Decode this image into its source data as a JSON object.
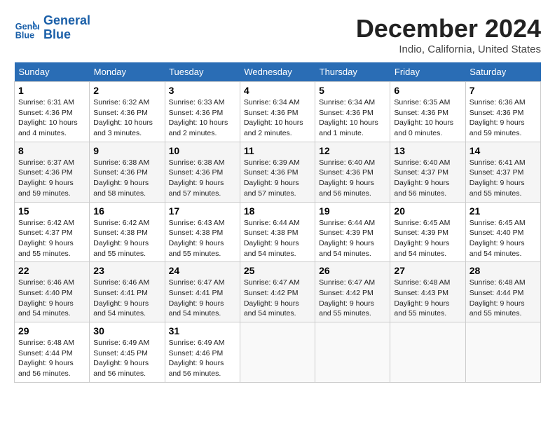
{
  "header": {
    "logo_line1": "General",
    "logo_line2": "Blue",
    "month": "December 2024",
    "location": "Indio, California, United States"
  },
  "weekdays": [
    "Sunday",
    "Monday",
    "Tuesday",
    "Wednesday",
    "Thursday",
    "Friday",
    "Saturday"
  ],
  "weeks": [
    [
      {
        "day": "1",
        "info": "Sunrise: 6:31 AM\nSunset: 4:36 PM\nDaylight: 10 hours\nand 4 minutes."
      },
      {
        "day": "2",
        "info": "Sunrise: 6:32 AM\nSunset: 4:36 PM\nDaylight: 10 hours\nand 3 minutes."
      },
      {
        "day": "3",
        "info": "Sunrise: 6:33 AM\nSunset: 4:36 PM\nDaylight: 10 hours\nand 2 minutes."
      },
      {
        "day": "4",
        "info": "Sunrise: 6:34 AM\nSunset: 4:36 PM\nDaylight: 10 hours\nand 2 minutes."
      },
      {
        "day": "5",
        "info": "Sunrise: 6:34 AM\nSunset: 4:36 PM\nDaylight: 10 hours\nand 1 minute."
      },
      {
        "day": "6",
        "info": "Sunrise: 6:35 AM\nSunset: 4:36 PM\nDaylight: 10 hours\nand 0 minutes."
      },
      {
        "day": "7",
        "info": "Sunrise: 6:36 AM\nSunset: 4:36 PM\nDaylight: 9 hours\nand 59 minutes."
      }
    ],
    [
      {
        "day": "8",
        "info": "Sunrise: 6:37 AM\nSunset: 4:36 PM\nDaylight: 9 hours\nand 59 minutes."
      },
      {
        "day": "9",
        "info": "Sunrise: 6:38 AM\nSunset: 4:36 PM\nDaylight: 9 hours\nand 58 minutes."
      },
      {
        "day": "10",
        "info": "Sunrise: 6:38 AM\nSunset: 4:36 PM\nDaylight: 9 hours\nand 57 minutes."
      },
      {
        "day": "11",
        "info": "Sunrise: 6:39 AM\nSunset: 4:36 PM\nDaylight: 9 hours\nand 57 minutes."
      },
      {
        "day": "12",
        "info": "Sunrise: 6:40 AM\nSunset: 4:36 PM\nDaylight: 9 hours\nand 56 minutes."
      },
      {
        "day": "13",
        "info": "Sunrise: 6:40 AM\nSunset: 4:37 PM\nDaylight: 9 hours\nand 56 minutes."
      },
      {
        "day": "14",
        "info": "Sunrise: 6:41 AM\nSunset: 4:37 PM\nDaylight: 9 hours\nand 55 minutes."
      }
    ],
    [
      {
        "day": "15",
        "info": "Sunrise: 6:42 AM\nSunset: 4:37 PM\nDaylight: 9 hours\nand 55 minutes."
      },
      {
        "day": "16",
        "info": "Sunrise: 6:42 AM\nSunset: 4:38 PM\nDaylight: 9 hours\nand 55 minutes."
      },
      {
        "day": "17",
        "info": "Sunrise: 6:43 AM\nSunset: 4:38 PM\nDaylight: 9 hours\nand 55 minutes."
      },
      {
        "day": "18",
        "info": "Sunrise: 6:44 AM\nSunset: 4:38 PM\nDaylight: 9 hours\nand 54 minutes."
      },
      {
        "day": "19",
        "info": "Sunrise: 6:44 AM\nSunset: 4:39 PM\nDaylight: 9 hours\nand 54 minutes."
      },
      {
        "day": "20",
        "info": "Sunrise: 6:45 AM\nSunset: 4:39 PM\nDaylight: 9 hours\nand 54 minutes."
      },
      {
        "day": "21",
        "info": "Sunrise: 6:45 AM\nSunset: 4:40 PM\nDaylight: 9 hours\nand 54 minutes."
      }
    ],
    [
      {
        "day": "22",
        "info": "Sunrise: 6:46 AM\nSunset: 4:40 PM\nDaylight: 9 hours\nand 54 minutes."
      },
      {
        "day": "23",
        "info": "Sunrise: 6:46 AM\nSunset: 4:41 PM\nDaylight: 9 hours\nand 54 minutes."
      },
      {
        "day": "24",
        "info": "Sunrise: 6:47 AM\nSunset: 4:41 PM\nDaylight: 9 hours\nand 54 minutes."
      },
      {
        "day": "25",
        "info": "Sunrise: 6:47 AM\nSunset: 4:42 PM\nDaylight: 9 hours\nand 54 minutes."
      },
      {
        "day": "26",
        "info": "Sunrise: 6:47 AM\nSunset: 4:42 PM\nDaylight: 9 hours\nand 55 minutes."
      },
      {
        "day": "27",
        "info": "Sunrise: 6:48 AM\nSunset: 4:43 PM\nDaylight: 9 hours\nand 55 minutes."
      },
      {
        "day": "28",
        "info": "Sunrise: 6:48 AM\nSunset: 4:44 PM\nDaylight: 9 hours\nand 55 minutes."
      }
    ],
    [
      {
        "day": "29",
        "info": "Sunrise: 6:48 AM\nSunset: 4:44 PM\nDaylight: 9 hours\nand 56 minutes."
      },
      {
        "day": "30",
        "info": "Sunrise: 6:49 AM\nSunset: 4:45 PM\nDaylight: 9 hours\nand 56 minutes."
      },
      {
        "day": "31",
        "info": "Sunrise: 6:49 AM\nSunset: 4:46 PM\nDaylight: 9 hours\nand 56 minutes."
      },
      {
        "day": "",
        "info": ""
      },
      {
        "day": "",
        "info": ""
      },
      {
        "day": "",
        "info": ""
      },
      {
        "day": "",
        "info": ""
      }
    ]
  ]
}
